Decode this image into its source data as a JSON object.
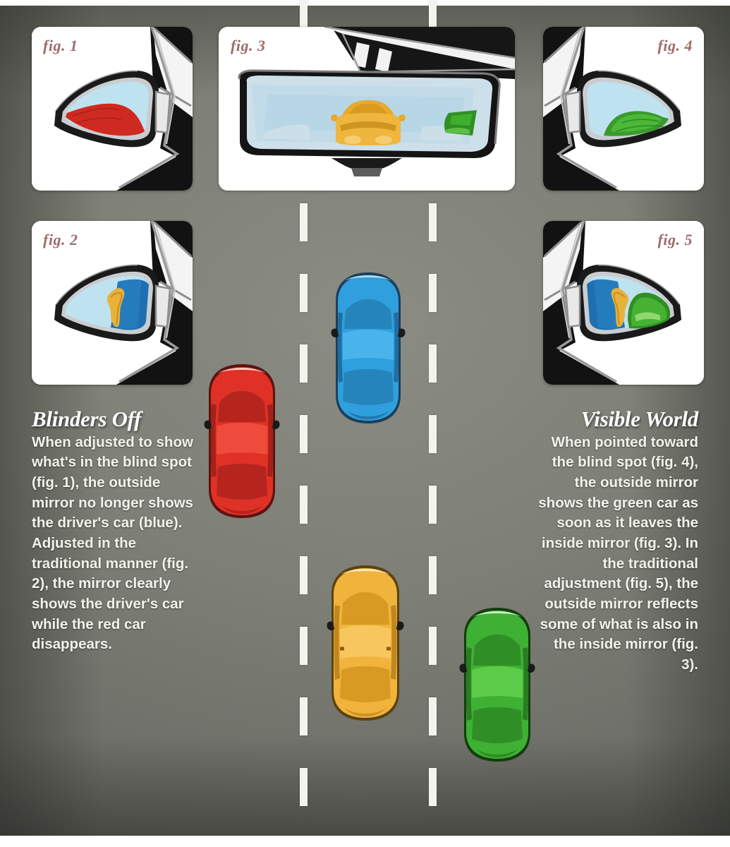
{
  "figures": [
    {
      "id": "fig1",
      "label": "fig. 1",
      "caption_color": "#9d6b6b",
      "description": "Driver-side mirror adjusted outward: a red car fills the lower-left of the mirror glass, the driver's own car is not visible."
    },
    {
      "id": "fig2",
      "label": "fig. 2",
      "caption_color": "#9d6b6b",
      "description": "Driver-side mirror adjusted traditionally: the blue body of the driver's own car and a yellow sliver are visible, the red car has disappeared."
    },
    {
      "id": "fig3",
      "label": "fig. 3",
      "caption_color": "#9d6b6b",
      "description": "Inside rearview mirror: a yellow car sits centered behind, a green car is entering at the right edge of the glass."
    },
    {
      "id": "fig4",
      "label": "fig. 4",
      "caption_color": "#9d6b6b",
      "description": "Passenger-side mirror pointed toward the blind spot: a green car appears in the lower-left of the mirror glass."
    },
    {
      "id": "fig5",
      "label": "fig. 5",
      "caption_color": "#9d6b6b",
      "description": "Passenger-side mirror adjusted traditionally: the blue body of the driver's own car, a yellow sliver, and the green car all appear together."
    }
  ],
  "columns": {
    "left": {
      "heading": "Blinders Off",
      "body": "When adjusted to show what's in the blind spot (fig. 1), the outside mirror no longer shows the driver's car (blue). Adjusted in the traditional manner (fig. 2), the mirror clearly shows the driver's car while the red car disappears."
    },
    "right": {
      "heading": "Visible World",
      "body": "When pointed toward the blind spot (fig. 4), the outside mirror shows the green car as soon as it leaves the inside mirror (fig. 3). In the traditional adjustment (fig. 5), the outside mirror reflects some of what is also in the inside mirror (fig. 3)."
    }
  },
  "road_scene": {
    "description": "Overhead view of a three-lane road with two dashed white lane dividers.",
    "lane_divider_count": 2,
    "cars": [
      {
        "name": "blue-car",
        "role": "driver's car",
        "color": "#2f9fdd",
        "lane": "center",
        "position": "ahead"
      },
      {
        "name": "red-car",
        "role": "car in left blind spot",
        "color": "#e03127",
        "lane": "left",
        "position": "alongside-left"
      },
      {
        "name": "yellow-car",
        "role": "car directly behind",
        "color": "#f0b43c",
        "lane": "center",
        "position": "behind"
      },
      {
        "name": "green-car",
        "role": "car in right blind spot",
        "color": "#3eb134",
        "lane": "right",
        "position": "alongside-right"
      }
    ]
  },
  "palette": {
    "road": "#7e7f76",
    "lane_marking": "#f4f4ef",
    "panel_background": "#ffffff",
    "panel_shadow": "#000000",
    "mirror_glass": "#cfe4ef",
    "heading_text": "#ffffff",
    "body_text": "#f2f2ee",
    "fig_label": "#9d6b6b"
  }
}
